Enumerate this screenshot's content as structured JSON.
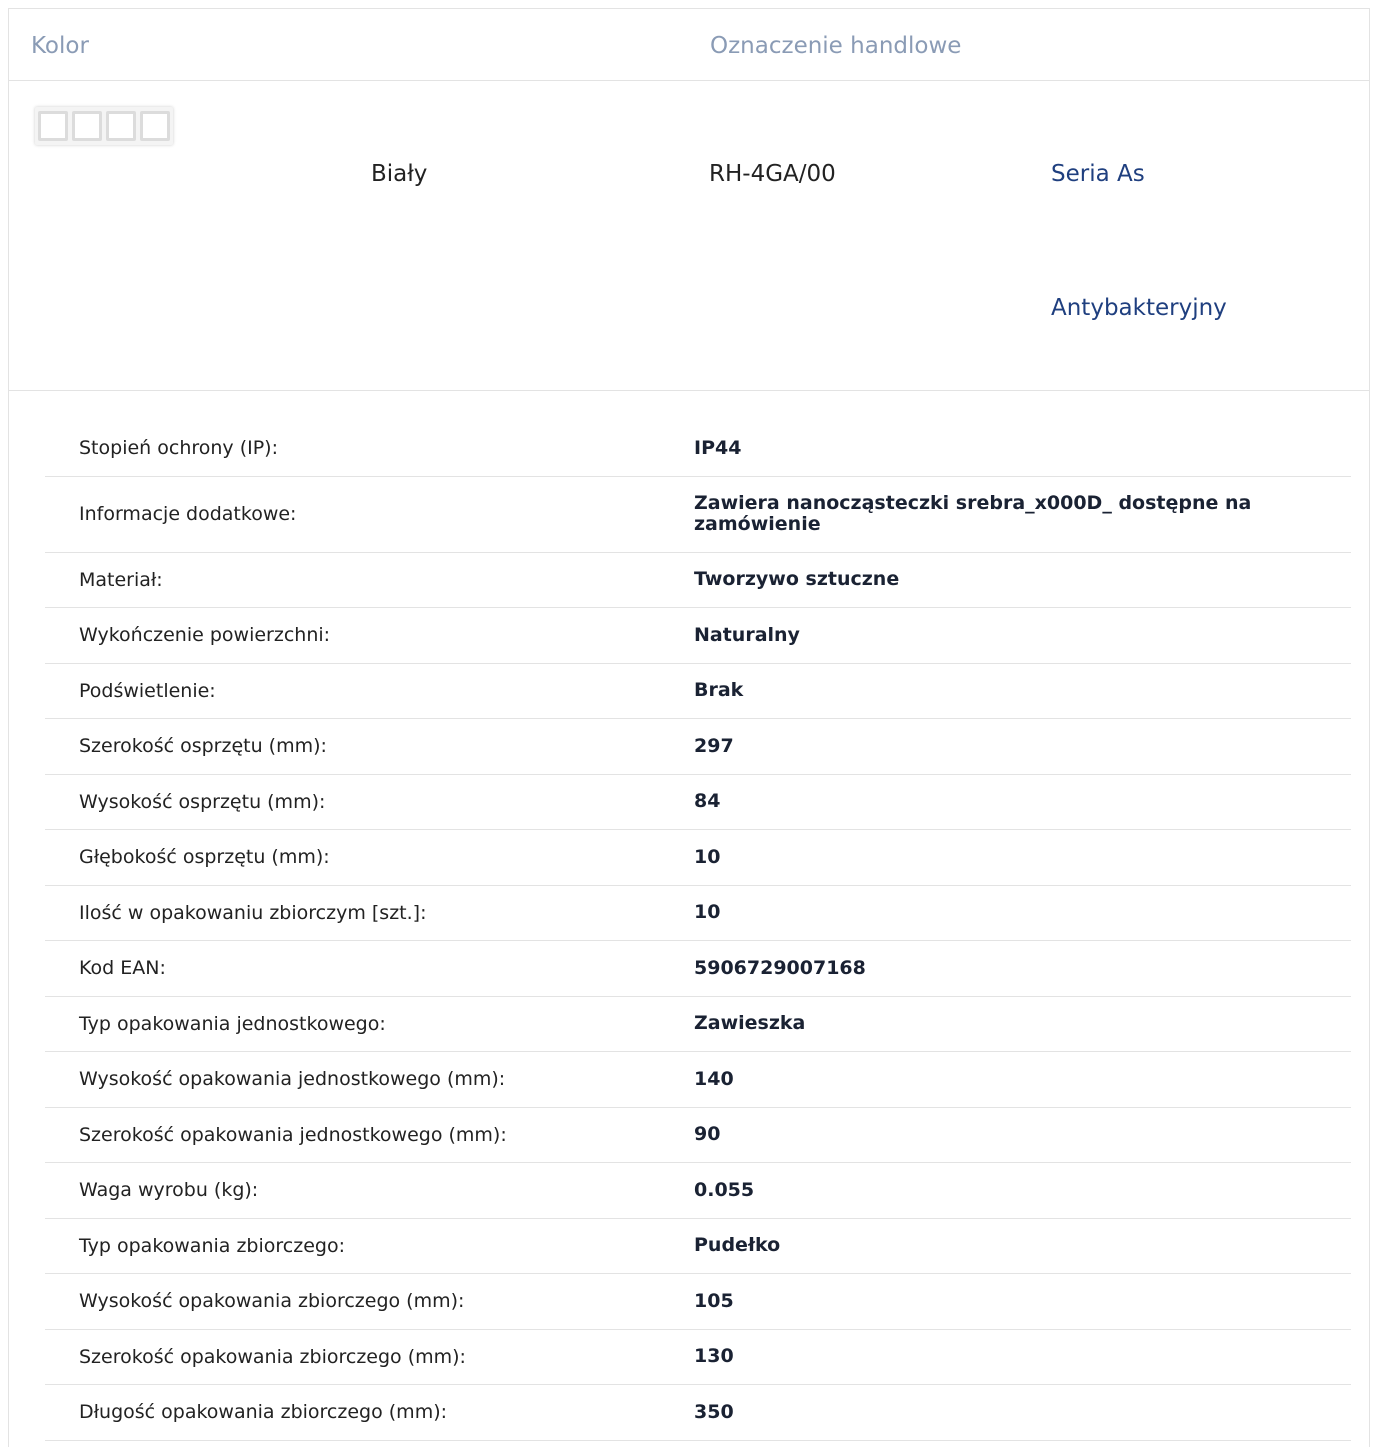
{
  "header": {
    "color_label": "Kolor",
    "trade_label": "Oznaczenie handlowe"
  },
  "product": {
    "thumbnail_icon": "four-gang-frame-icon",
    "color": "Biały",
    "code": "RH-4GA/00",
    "series_link": "Seria As",
    "feature_link": "Antybakteryjny"
  },
  "specs": [
    {
      "label": "Stopień ochrony (IP):",
      "value": "IP44"
    },
    {
      "label": "Informacje dodatkowe:",
      "value": " Zawiera nanocząsteczki srebra_x000D_ dostępne na zamówienie"
    },
    {
      "label": "Materiał:",
      "value": "Tworzywo sztuczne"
    },
    {
      "label": "Wykończenie powierzchni:",
      "value": "Naturalny"
    },
    {
      "label": "Podświetlenie:",
      "value": "Brak"
    },
    {
      "label": "Szerokość osprzętu (mm):",
      "value": "297"
    },
    {
      "label": "Wysokość osprzętu (mm):",
      "value": "84"
    },
    {
      "label": "Głębokość osprzętu (mm):",
      "value": "10"
    },
    {
      "label": "Ilość w opakowaniu zbiorczym [szt.]:",
      "value": "10"
    },
    {
      "label": "Kod EAN:",
      "value": "5906729007168"
    },
    {
      "label": "Typ opakowania jednostkowego:",
      "value": "Zawieszka"
    },
    {
      "label": "Wysokość opakowania jednostkowego (mm):",
      "value": "140"
    },
    {
      "label": "Szerokość opakowania jednostkowego (mm):",
      "value": "90"
    },
    {
      "label": "Waga wyrobu (kg):",
      "value": "0.055"
    },
    {
      "label": "Typ opakowania zbiorczego:",
      "value": "Pudełko"
    },
    {
      "label": "Wysokość opakowania zbiorczego (mm):",
      "value": "105"
    },
    {
      "label": "Szerokość opakowania zbiorczego (mm):",
      "value": "130"
    },
    {
      "label": "Długość opakowania zbiorczego (mm):",
      "value": "350"
    }
  ]
}
